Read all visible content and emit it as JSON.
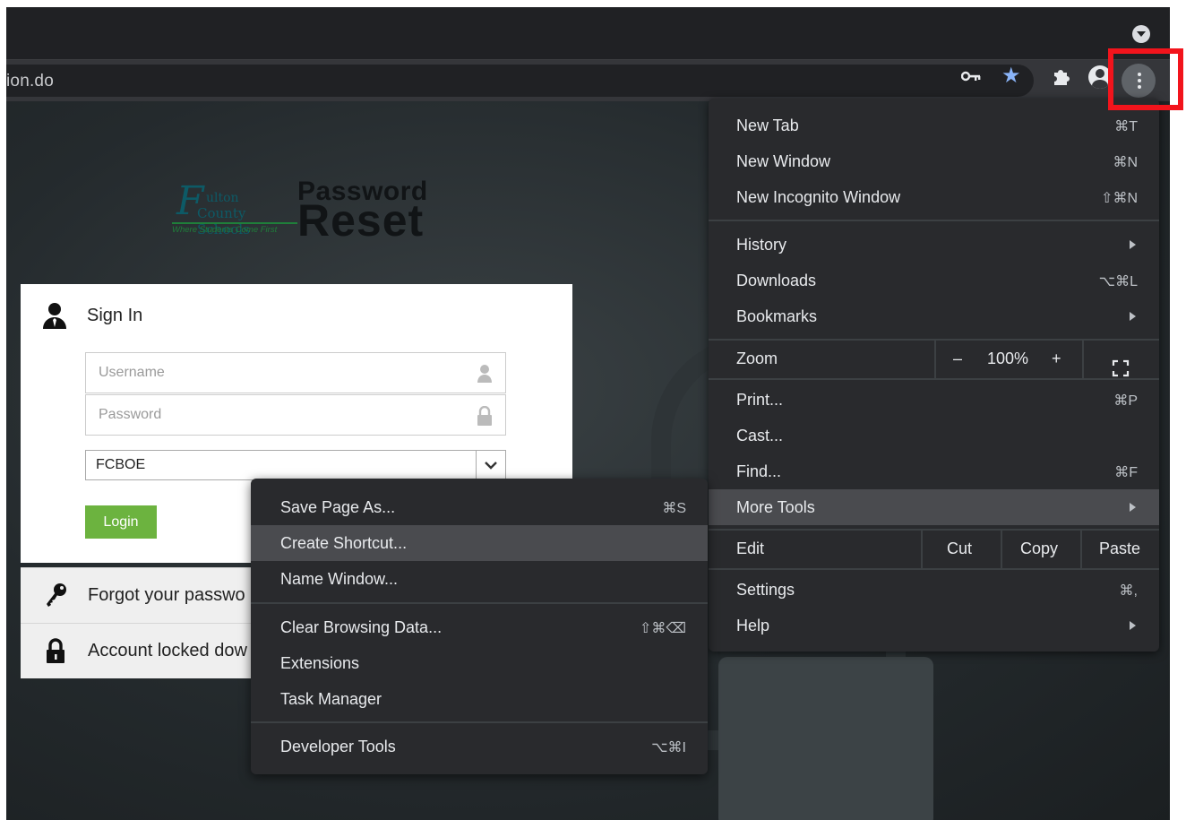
{
  "browser": {
    "url": "ion.do"
  },
  "signin": {
    "title": "Sign In",
    "username_placeholder": "Username",
    "password_placeholder": "Password",
    "domain_value": "FCBOE",
    "login_label": "Login",
    "forgot_label": "Forgot your passwo",
    "locked_label": "Account locked dow"
  },
  "logo": {
    "school_initial": "F",
    "school_line1": "ulton",
    "school_line2": "County Schools",
    "tagline": "Where Students Come First",
    "word1": "Password",
    "word2": "Reset"
  },
  "menu": {
    "new_tab": {
      "label": "New Tab",
      "shortcut": "⌘T"
    },
    "new_window": {
      "label": "New Window",
      "shortcut": "⌘N"
    },
    "new_incognito": {
      "label": "New Incognito Window",
      "shortcut": "⇧⌘N"
    },
    "history": {
      "label": "History"
    },
    "downloads": {
      "label": "Downloads",
      "shortcut": "⌥⌘L"
    },
    "bookmarks": {
      "label": "Bookmarks"
    },
    "zoom": {
      "label": "Zoom",
      "minus": "–",
      "level": "100%",
      "plus": "+"
    },
    "print": {
      "label": "Print...",
      "shortcut": "⌘P"
    },
    "cast": {
      "label": "Cast..."
    },
    "find": {
      "label": "Find...",
      "shortcut": "⌘F"
    },
    "more_tools": {
      "label": "More Tools"
    },
    "edit": {
      "label": "Edit",
      "cut": "Cut",
      "copy": "Copy",
      "paste": "Paste"
    },
    "settings": {
      "label": "Settings",
      "shortcut": "⌘,"
    },
    "help": {
      "label": "Help"
    }
  },
  "submenu": {
    "save_page": {
      "label": "Save Page As...",
      "shortcut": "⌘S"
    },
    "create_shortcut": {
      "label": "Create Shortcut..."
    },
    "name_window": {
      "label": "Name Window..."
    },
    "clear_data": {
      "label": "Clear Browsing Data...",
      "shortcut": "⇧⌘⌫"
    },
    "extensions": {
      "label": "Extensions"
    },
    "task_manager": {
      "label": "Task Manager"
    },
    "dev_tools": {
      "label": "Developer Tools",
      "shortcut": "⌥⌘I"
    }
  },
  "icons": [
    "profile-dropdown-icon",
    "key-icon",
    "star-icon",
    "puzzle-icon",
    "avatar-icon",
    "kebab-menu-icon",
    "user-icon",
    "lock-icon",
    "chevron-down-icon",
    "fullscreen-icon",
    "submenu-arrow-icon"
  ],
  "colors": {
    "highlight": "#f2141c",
    "login_green": "#6cb33f",
    "star_blue": "#8ab4f8",
    "menu_bg": "#292a2d"
  }
}
